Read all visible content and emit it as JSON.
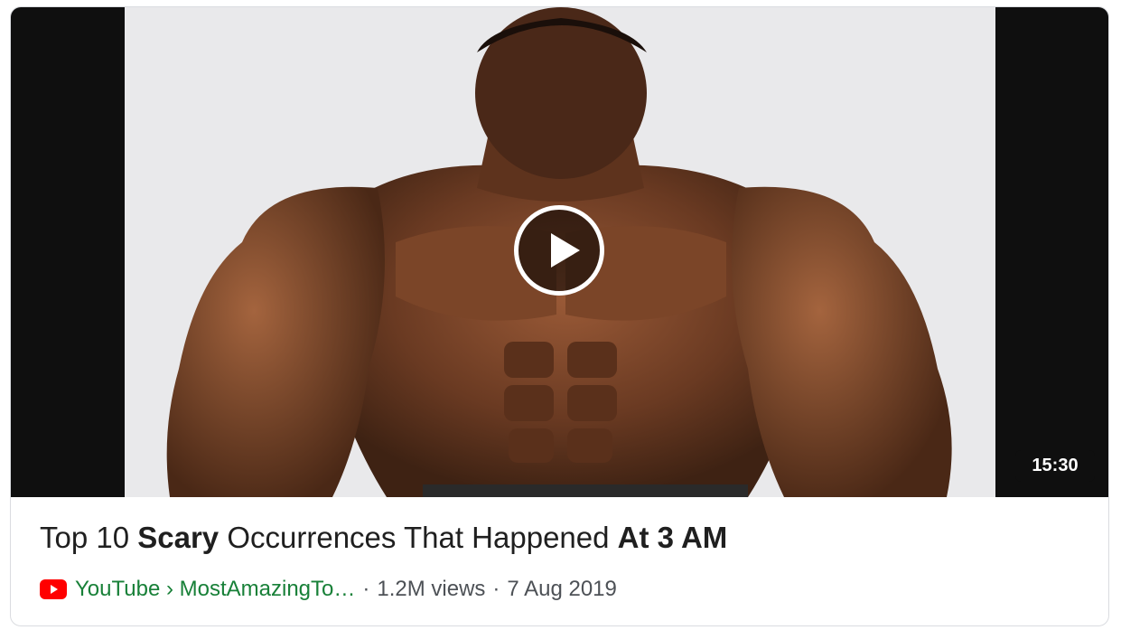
{
  "video": {
    "duration": "15:30",
    "play_icon": "play-icon"
  },
  "title": {
    "part1": "Top 10 ",
    "part2": "Scary",
    "part3": " Occurrences That Happened ",
    "part4": "At 3 AM"
  },
  "meta": {
    "source_icon": "youtube-icon",
    "source": "YouTube › MostAmazingTo…",
    "dot1": "·",
    "views": "1.2M views",
    "dot2": "·",
    "date": "7 Aug 2019"
  },
  "colors": {
    "source_link": "#188038",
    "youtube_red": "#ff0000",
    "title_text": "#1f1f1f",
    "meta_text": "#4d5156"
  }
}
